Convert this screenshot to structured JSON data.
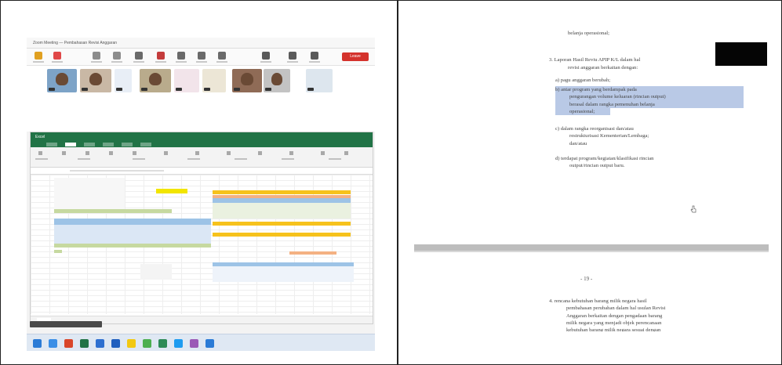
{
  "meeting": {
    "title": "Zoom Meeting — Pembahasan Revisi Anggaran",
    "leave_label": "Leave"
  },
  "spreadsheet": {
    "title": "Excel"
  },
  "document": {
    "top_line": "belanja operasional;",
    "item3_line1": "3.  Laporan Hasil Reviu APIP K/L dalam hal",
    "item3_line2": "revisi anggaran berkaitan dengan:",
    "a": "a)  pagu anggaran berubah;",
    "b_lines": [
      "b)  antar  program  yang  berdampak  pada",
      "pengurangan volume keluaran (rincian output)",
      "berasal dalam rangka pemenuhan belanja",
      "operasional;"
    ],
    "c_lines": [
      "c)  dalam   rangka   reorganisasi   dan/atau",
      "restrukturisasi   Kementerian/Lembaga;",
      "dan/atau"
    ],
    "d_lines": [
      "d)  terdapat program/kegiatan/klasifikasi rincian",
      "output/rincian output baru."
    ],
    "page_number": "- 19 -",
    "item4_lines": [
      "4.  rencana kebutuhan barang milik negara hasil",
      "pembahasan perubahan dalam hal usulan Revisi",
      "Anggaran berkaitan dengan pengadaan barang",
      "milik negara yang menjadi objek perencanaan",
      "kebutuhan barang milik negara sesuai dengan"
    ]
  },
  "colors": {
    "excel_green": "#217346",
    "highlight": "#b9c9e6",
    "leave_red": "#d4322c",
    "redaction": "#050505"
  }
}
